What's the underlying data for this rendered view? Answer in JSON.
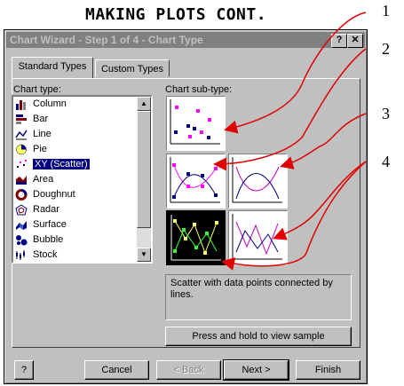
{
  "heading": "MAKING PLOTS CONT.",
  "window": {
    "title": "Chart Wizard - Step 1 of 4 - Chart Type",
    "help_btn": "?",
    "close_btn": "✕"
  },
  "tabs": [
    "Standard Types",
    "Custom Types"
  ],
  "chart_type_label": "Chart type:",
  "chart_types": [
    "Column",
    "Bar",
    "Line",
    "Pie",
    "XY (Scatter)",
    "Area",
    "Doughnut",
    "Radar",
    "Surface",
    "Bubble",
    "Stock"
  ],
  "selected_chart_type": "XY (Scatter)",
  "subtype_label": "Chart sub-type:",
  "description": "Scatter with data points connected by lines.",
  "sample_button": "Press and hold to view sample",
  "footer": {
    "help": "?",
    "cancel": "Cancel",
    "back": "< Back",
    "next": "Next >",
    "finish": "Finish"
  },
  "annotations": [
    "1",
    "2",
    "3",
    "4"
  ],
  "colors": {
    "arrow": "#e00000",
    "selection": "#000080",
    "point_magenta": "#ff00ff",
    "point_navy": "#000080",
    "highlight_yellow": "#ffff66",
    "highlight_green": "#33ff33"
  }
}
